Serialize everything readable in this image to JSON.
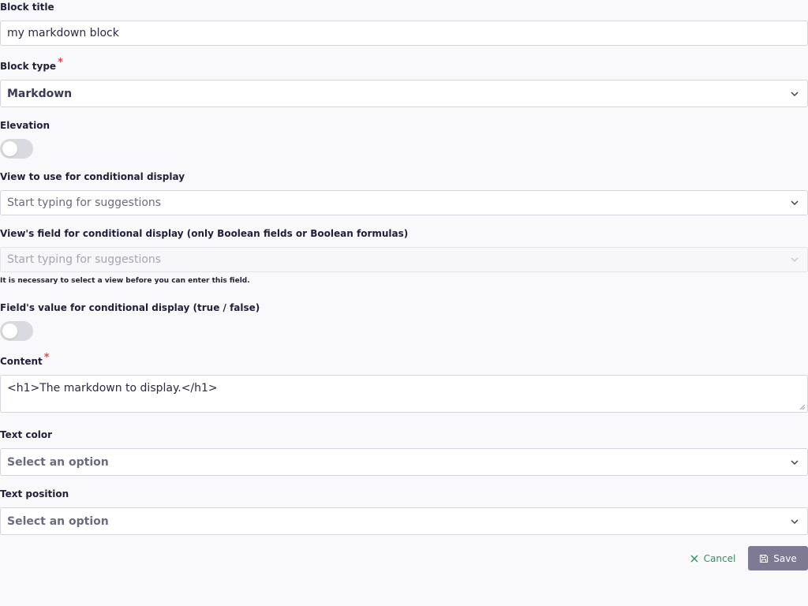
{
  "form": {
    "block_title": {
      "label": "Block title",
      "value": "my markdown block"
    },
    "block_type": {
      "label": "Block type",
      "required_mark": "*",
      "value": "Markdown"
    },
    "elevation": {
      "label": "Elevation",
      "enabled": false
    },
    "view_conditional": {
      "label": "View to use for conditional display",
      "placeholder": "Start typing for suggestions"
    },
    "view_field": {
      "label": "View's field for conditional display (only Boolean fields or Boolean formulas)",
      "placeholder": "Start typing for suggestions",
      "help": "It is necessary to select a view before you can enter this field."
    },
    "field_value": {
      "label": "Field's value for conditional display (true / false)",
      "enabled": false
    },
    "content": {
      "label": "Content",
      "required_mark": "*",
      "value": "<h1>The markdown to display.</h1>"
    },
    "text_color": {
      "label": "Text color",
      "placeholder": "Select an option"
    },
    "text_position": {
      "label": "Text position",
      "placeholder": "Select an option"
    }
  },
  "actions": {
    "cancel_label": "Cancel",
    "save_label": "Save"
  },
  "colors": {
    "accent_green": "#2f8f5f",
    "save_bg": "#7e7a94",
    "required": "#e5484d"
  },
  "icons": {
    "chevron": "chevron-down-icon",
    "cancel": "close-icon",
    "save": "floppy-disk-icon"
  }
}
